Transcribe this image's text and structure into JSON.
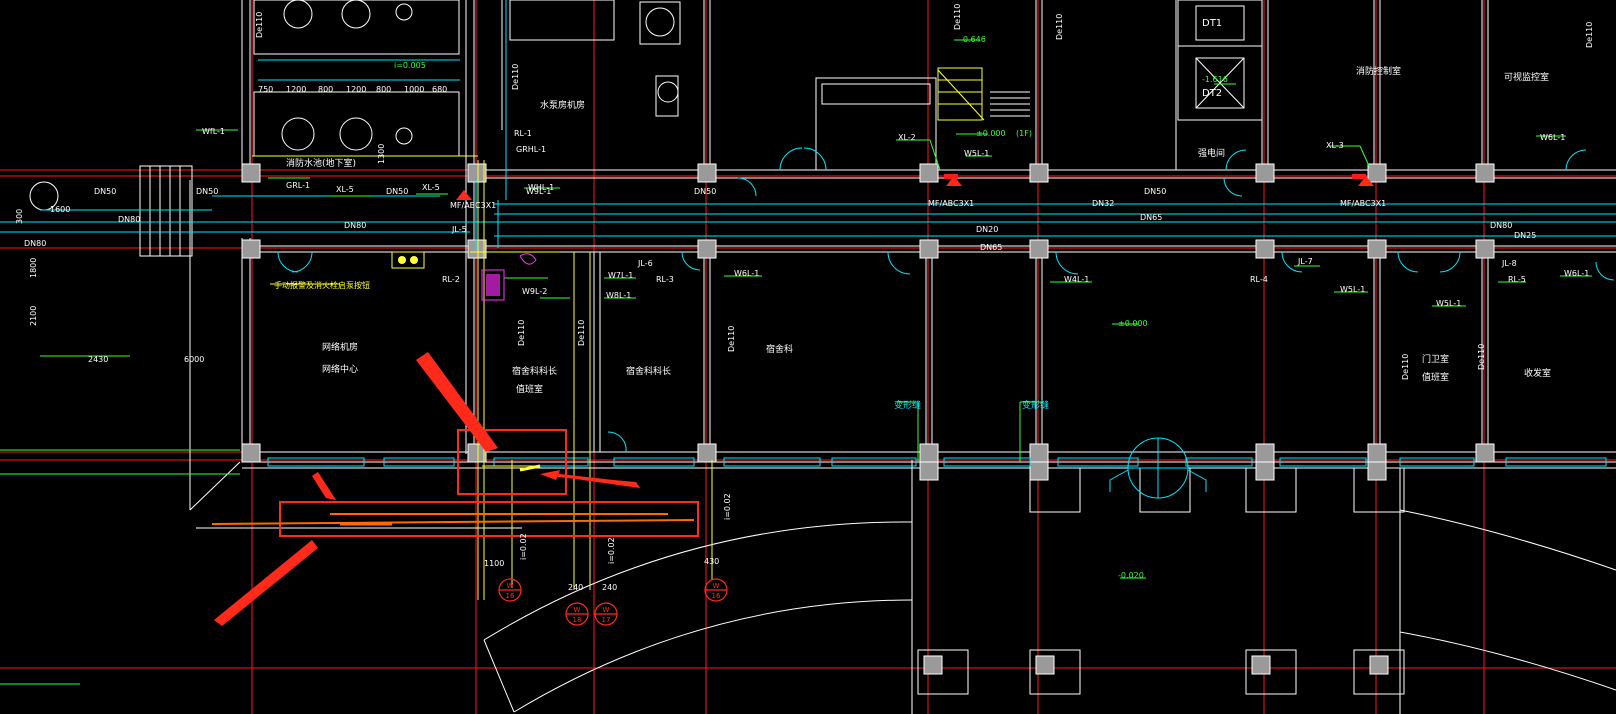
{
  "colors": {
    "background": "#000000",
    "wall": "#ffffff",
    "axis": "#ff1a1a",
    "pipe_main": "#00e5ff",
    "pipe_drain": "#ffff33",
    "pipe_green": "#33ff33",
    "annotation": "#ff2a1a",
    "markup_orange": "#ff6a00",
    "column": "#9a9a9a",
    "magenta": "#ff33ff",
    "text_white": "#ffffff"
  },
  "canvas": {
    "label": "cad-drawing-canvas"
  },
  "room_labels": {
    "network_room": "网络机房",
    "network_center": "网络中心",
    "dorm_a": "宿舍科科长",
    "dorm_b": "宿舍科科长",
    "dorm_office": "宿舍科",
    "clerk_room": "值班室",
    "water_pump": "水泵房机房",
    "security_room": "消防控制室",
    "kitchen": "可视监控室",
    "electric": "强电间",
    "guard": "门卫室",
    "guard_duty": "值班室",
    "mail": "收发室",
    "deform_a": "变形缝",
    "deform_b": "变形缝",
    "fire_alarm_note": "手动报警及消火栓启泵按钮",
    "equip_note": "消防水池(地下室)"
  },
  "pipe_labels": {
    "wfl_1a": "WfL-1",
    "wfl_1b": "W6L-1",
    "wfl_1c": "W6L-1",
    "wfl_1d": "W5L-1",
    "wfl_1e": "W6L-1",
    "w9l_1": "W9L-1",
    "w9l_2": "W9L-2",
    "w7l_1": "W7L-1",
    "w8l_1": "W8L-1",
    "w5l_1": "W5L-1",
    "w4l_1": "W4L-1",
    "w6l_right": "W6L-1",
    "xl_5a": "XL-5",
    "xl_5b": "XL-5",
    "xl_2": "XL-2",
    "xl_3": "XL-3",
    "rl_1": "RL-1",
    "rl_2": "RL-2",
    "rl_3": "RL-3",
    "rl_4": "RL-4",
    "rl_5": "RL-5",
    "jl_5": "JL-5",
    "jl_6": "JL-6",
    "jl_7": "JL-7",
    "jl_8": "JL-8",
    "grl_1": "GRL-1",
    "grhl_1": "GRHL-1",
    "whl_1": "WHL-1",
    "dn50_a": "DN50",
    "dn50_b": "DN50",
    "dn50_c": "DN50",
    "dn50_d": "DN50",
    "dn50_e": "DN50",
    "dn80_a": "DN80",
    "dn80_b": "DN80",
    "dn80_c": "DN80",
    "dn80_d": "DN80",
    "dn65": "DN65",
    "dn65_b": "DN65",
    "dn32": "DN32",
    "dn20": "DN20",
    "dn25": "DN25",
    "de110_a": "De110",
    "de110_b": "De110",
    "de110_c": "De110",
    "de110_d": "De110",
    "de110_e": "De110",
    "de110_f": "De110",
    "de110_g": "De110",
    "de110_h": "De110",
    "de110_i": "De110",
    "de110_j": "De110",
    "slope_a": "i=0.02",
    "slope_b": "i=0.02",
    "slope_c": "i=0.02",
    "slope_top": "i=0.005",
    "mf_a": "MF/ABC3X1",
    "mf_b": "MF/ABC3X1",
    "mf_c": "MF/ABC3X1"
  },
  "elevations": {
    "el_a": "-0.646",
    "el_b": "±0.000",
    "el_b_floor": "(1F)",
    "el_c": "±0.000",
    "el_d": "-0.020",
    "el_e": "-1.616"
  },
  "dimensions": {
    "d_750": "750",
    "d_1200": "1200",
    "d_800a": "800",
    "d_1200b": "1200",
    "d_800b": "800",
    "d_1000": "1000",
    "d_680": "680",
    "d_1300": "1300",
    "d_2430": "2430",
    "d_6000": "6000",
    "d_1800": "1800",
    "d_2100": "2100",
    "d_1100": "1100",
    "d_240a": "240",
    "d_240b": "240",
    "d_430": "430",
    "d_300": "300",
    "d_1600": "1600"
  },
  "markers": {
    "w16a": "W",
    "w16a_n": "16",
    "w18": "W",
    "w18_n": "18",
    "w17": "W",
    "w17_n": "17",
    "w16b": "W",
    "w16b_n": "16"
  },
  "elevators": {
    "dt1": "DT1",
    "dt2": "DT2"
  }
}
